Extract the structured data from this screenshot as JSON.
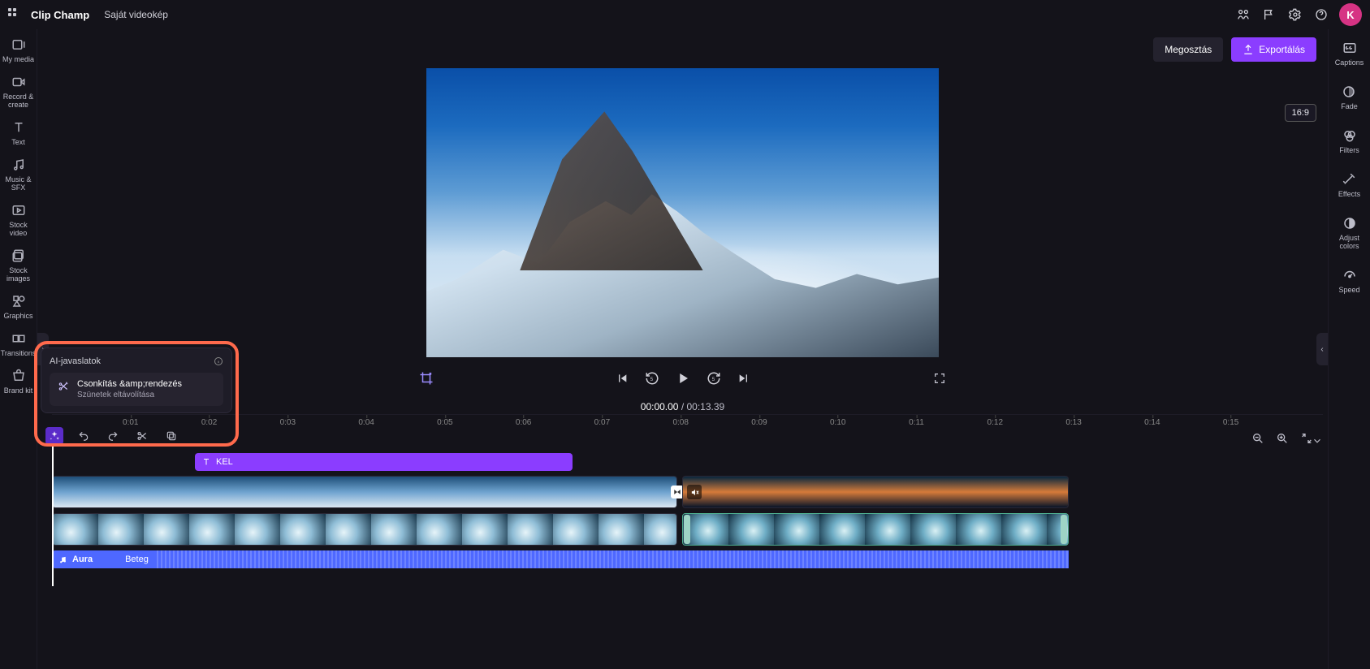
{
  "app": {
    "name": "Clip Champ",
    "project": "Saját videokép"
  },
  "avatar": {
    "initial": "K"
  },
  "header_actions": {
    "share": "Megosztás",
    "export": "Exportálás"
  },
  "aspect_badge": "16:9",
  "left_rail": [
    {
      "label": "My media"
    },
    {
      "label": "Record & create"
    },
    {
      "label": "Text"
    },
    {
      "label": "Music & SFX"
    },
    {
      "label": "Stock video"
    },
    {
      "label": "Stock images"
    },
    {
      "label": "Graphics"
    },
    {
      "label": "Transitions"
    },
    {
      "label": "Brand kit"
    }
  ],
  "right_rail": [
    {
      "label": "Captions"
    },
    {
      "label": "Fade"
    },
    {
      "label": "Filters"
    },
    {
      "label": "Effects"
    },
    {
      "label": "Adjust colors"
    },
    {
      "label": "Speed"
    }
  ],
  "playback": {
    "current": "00:00.00",
    "separator": " / ",
    "duration": "00:13.39"
  },
  "timeline": {
    "ticks": [
      "0:01",
      "0:02",
      "0:03",
      "0:04",
      "0:05",
      "0:06",
      "0:07",
      "0:08",
      "0:09",
      "0:10",
      "0:11",
      "0:12",
      "0:13",
      "0:14",
      "0:15"
    ],
    "title_clip": {
      "label": "KEL"
    },
    "audio_clip": {
      "title": "Aura",
      "artist": "Beteg"
    }
  },
  "ai_popup": {
    "header": "AI-javaslatok",
    "suggestion_title": "Csonkítás &amp;rendezés",
    "suggestion_subtitle": "Szünetek eltávolítása"
  }
}
